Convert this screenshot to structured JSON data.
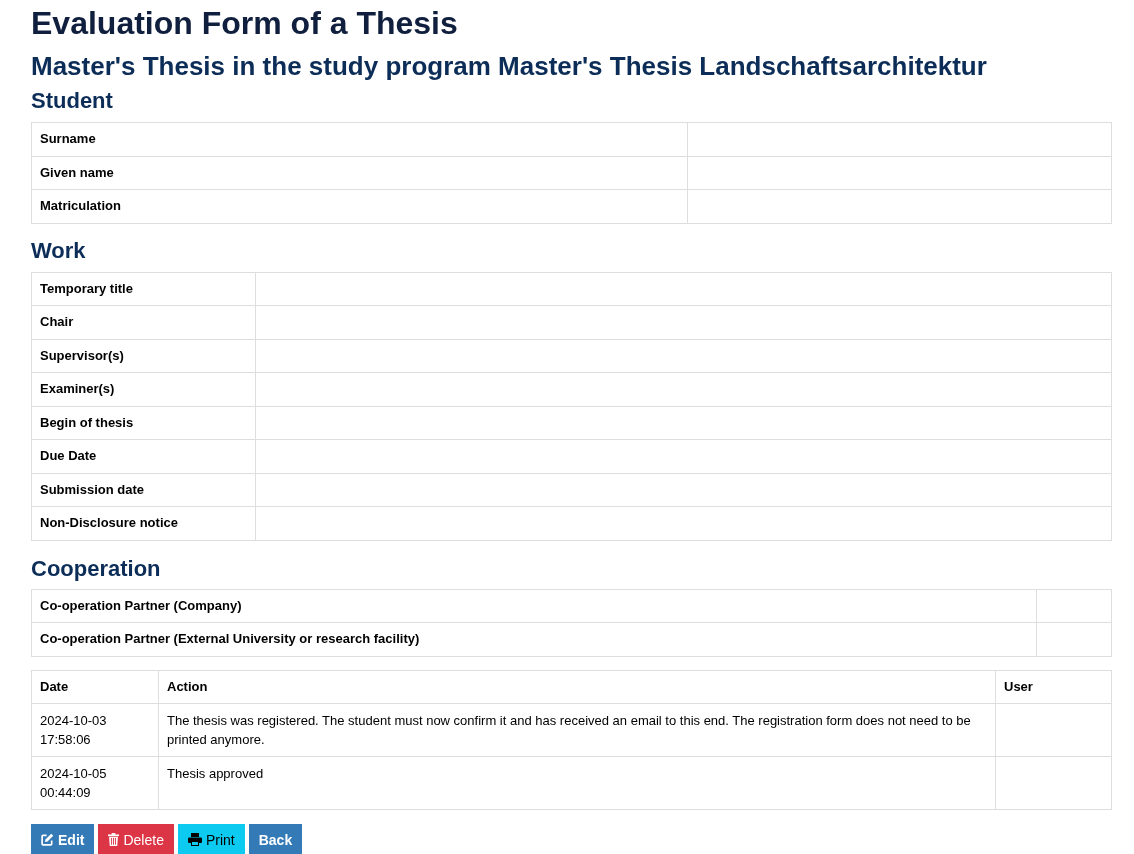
{
  "title": "Evaluation Form of a Thesis",
  "subtitle": "Master's Thesis in the study program Master's Thesis Landschaftsarchitektur",
  "sections": [
    {
      "kind": "student",
      "heading": "Student",
      "rows": [
        {
          "label": "Surname"
        },
        {
          "label": "Given name"
        },
        {
          "label": "Matriculation"
        }
      ]
    },
    {
      "kind": "work",
      "heading": "Work",
      "rows": [
        {
          "label": "Temporary title"
        },
        {
          "label": "Chair"
        },
        {
          "label": "Supervisor(s)"
        },
        {
          "label": "Examiner(s)"
        },
        {
          "label": "Begin of thesis"
        },
        {
          "label": "Due Date"
        },
        {
          "label": "Submission date"
        },
        {
          "label": "Non-Disclosure notice"
        }
      ]
    },
    {
      "kind": "cooperation",
      "heading": "Cooperation",
      "rows": [
        {
          "label": "Co-operation Partner (Company)"
        },
        {
          "label": "Co-operation Partner (External University or research facility)"
        }
      ]
    }
  ],
  "history": {
    "columns": [
      "Date",
      "Action",
      "User"
    ],
    "rows": [
      {
        "date": "2024-10-03 17:58:06",
        "action": "The thesis was registered. The student must now confirm it and has received an email to this end. The registration form does not need to be printed anymore."
      },
      {
        "date": "2024-10-05 00:44:09",
        "action": "Thesis approved"
      }
    ]
  },
  "buttons": [
    {
      "kind": "edit",
      "label": "Edit"
    },
    {
      "kind": "delete",
      "label": "Delete"
    },
    {
      "kind": "print",
      "label": "Print"
    },
    {
      "kind": "back",
      "label": "Back"
    }
  ]
}
